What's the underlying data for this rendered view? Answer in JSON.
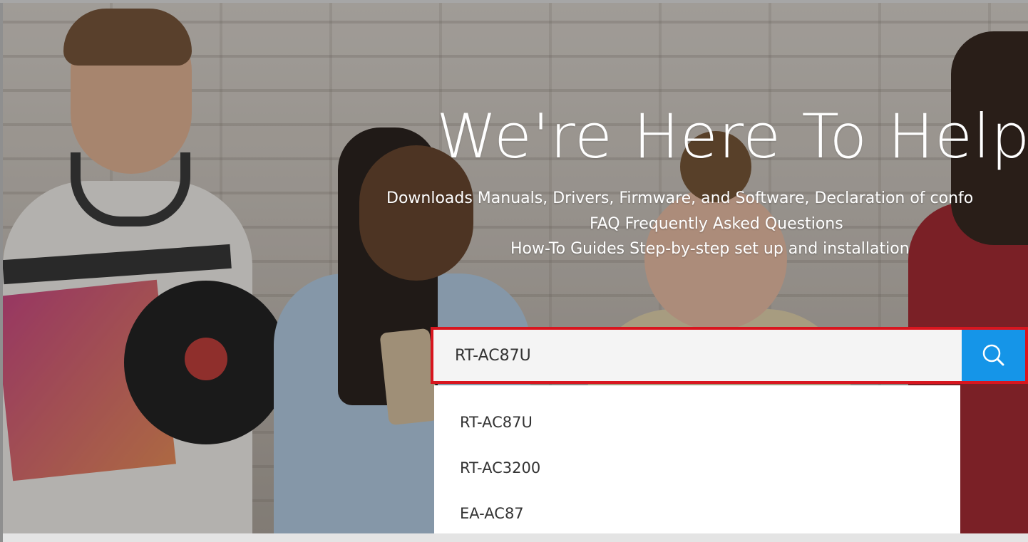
{
  "hero": {
    "headline": "We're Here To Help!",
    "lines": [
      "Downloads Manuals, Drivers, Firmware, and Software, Declaration of confo",
      "FAQ Frequently Asked Questions",
      "How-To Guides Step-by-step set up and installation"
    ]
  },
  "search": {
    "value": "RT-AC87U",
    "button_icon": "search-icon",
    "border_color": "#d8161f",
    "button_color": "#1595e8"
  },
  "suggestions": [
    "RT-AC87U",
    "RT-AC3200",
    "EA-AC87"
  ]
}
